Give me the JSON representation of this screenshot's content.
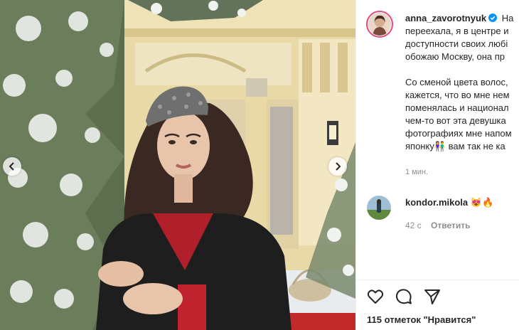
{
  "post": {
    "author": "anna_zavorotnyuk",
    "caption_lines": [
      "На",
      "переехала, я в центре и",
      "доступности своих любі",
      "обожаю Москву, она пр"
    ],
    "caption_lines_2": [
      "Со сменой цвета волос,",
      "кажется, что во мне нем",
      "поменялась и национал",
      "чем-то вот эта девушка",
      "фотографиях мне напом",
      "японку",
      "вам так не ка"
    ],
    "caption_emoji": "👫",
    "time_ago": "1 мин.",
    "likes_text": "115 отметок \"Нравится\""
  },
  "comment": {
    "username": "kondor.mikola",
    "emoji": "😻🔥",
    "time": "42 с",
    "reply_label": "Ответить"
  },
  "icons": [
    "chevron-left-icon",
    "chevron-right-icon",
    "verified-badge-icon",
    "heart-icon",
    "comment-icon",
    "share-icon"
  ],
  "colors": {
    "verified": "#0095f6",
    "story_ring": "#e44a7c",
    "muted": "#8e8e8e"
  }
}
